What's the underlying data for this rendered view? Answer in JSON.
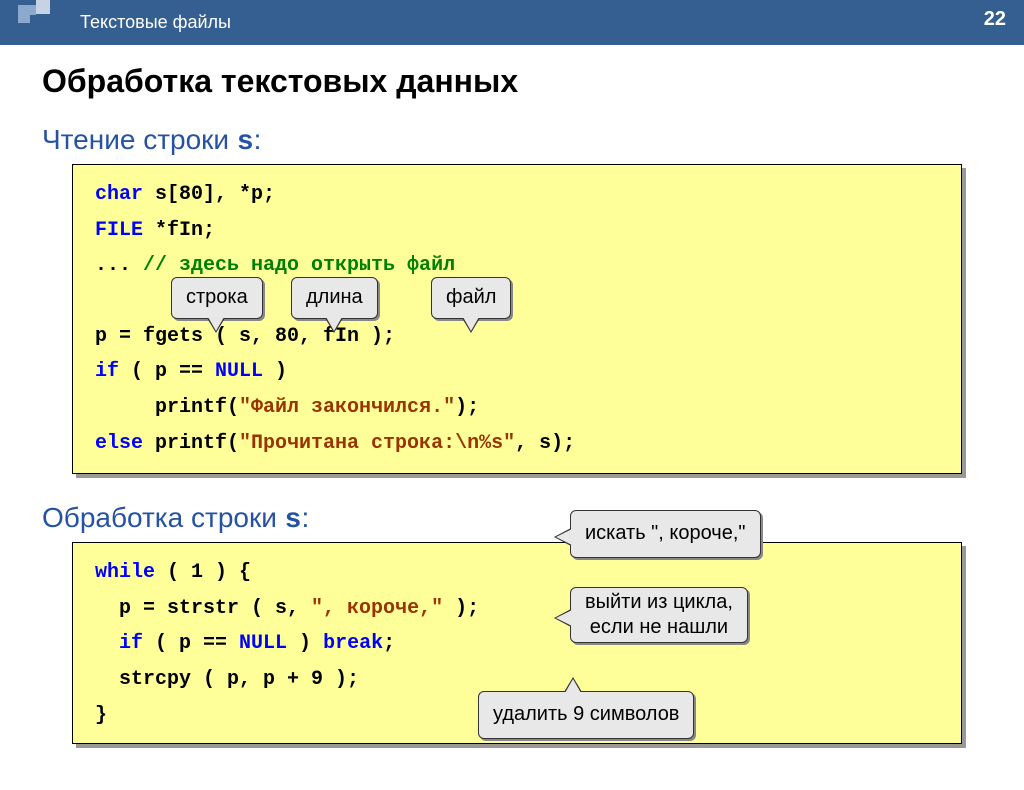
{
  "header": {
    "title": "Текстовые файлы",
    "page": "22"
  },
  "mainTitle": "Обработка текстовых данных",
  "section1": {
    "titlePrefix": "Чтение строки ",
    "titleVar": "s",
    "titleSuffix": ":",
    "code": {
      "line1a": "char",
      "line1b": " s[80], *p;",
      "line2a": "FILE",
      "line2b": " *fIn;",
      "line3a": "... ",
      "line3b": "// здесь надо открыть файл",
      "line4a": "",
      "line5": "p = fgets ( s, 80, fIn );",
      "line6a": "if",
      "line6b": " ( p == ",
      "line6c": "NULL",
      "line6d": " )",
      "line7a": "     printf(",
      "line7b": "\"Файл закончился.\"",
      "line7c": ");",
      "line8a": "else",
      "line8b": " printf(",
      "line8c": "\"Прочитана строка:\\n%s\"",
      "line8d": ", s);"
    },
    "callouts": {
      "c1": "строка",
      "c2": "длина",
      "c3": "файл"
    }
  },
  "section2": {
    "titlePrefix": "Обработка строки ",
    "titleVar": "s",
    "titleSuffix": ":",
    "code": {
      "line1a": "while",
      "line1b": " ( 1 ) {",
      "line2a": "  p = strstr ( s, ",
      "line2b": "\", короче,\"",
      "line2c": " );",
      "line3a": "  if",
      "line3b": " ( p == ",
      "line3c": "NULL",
      "line3d": " ) ",
      "line3e": "break",
      "line3f": ";",
      "line4": "  strcpy ( p, p + 9 );",
      "line5": "}"
    },
    "callouts": {
      "c1": "искать \", короче,\"",
      "c2a": "выйти из цикла,",
      "c2b": "если не нашли",
      "c3": "удалить 9 символов"
    }
  }
}
